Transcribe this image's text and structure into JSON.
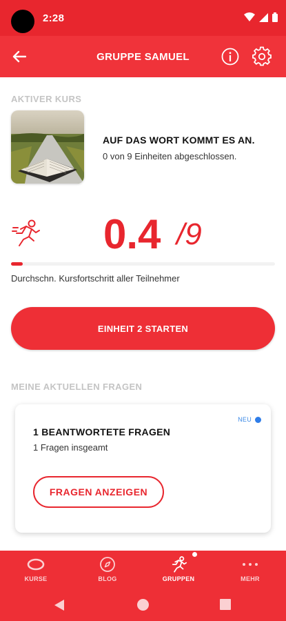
{
  "status": {
    "time": "2:28"
  },
  "app_bar": {
    "title": "GRUPPE SAMUEL"
  },
  "active_course": {
    "section_label": "AKTIVER KURS",
    "title": "AUF DAS WORT KOMMT ES AN.",
    "subtitle": "0 von 9 Einheiten abgeschlossen."
  },
  "progress": {
    "value": "0.4",
    "total": "/9",
    "fraction": 0.044,
    "caption": "Durchschn. Kursfortschritt aller Teilnehmer"
  },
  "start_button": {
    "label": "EINHEIT 2 STARTEN"
  },
  "questions": {
    "section_label": "MEINE AKTUELLEN FRAGEN",
    "badge": "NEU",
    "title": "1 BEANTWORTETE FRAGEN",
    "subtitle": "1 Fragen insgeamt",
    "button": "FRAGEN ANZEIGEN"
  },
  "bottom_nav": {
    "items": [
      {
        "label": "KURSE",
        "icon": "course-ring-icon"
      },
      {
        "label": "BLOG",
        "icon": "compass-icon"
      },
      {
        "label": "GRUPPEN",
        "icon": "runner-group-icon"
      },
      {
        "label": "MEHR",
        "icon": "more-dots-icon"
      }
    ]
  },
  "colors": {
    "primary": "#e8262e",
    "accent_blue": "#2f7de8",
    "muted_label": "#c4c4c4"
  }
}
